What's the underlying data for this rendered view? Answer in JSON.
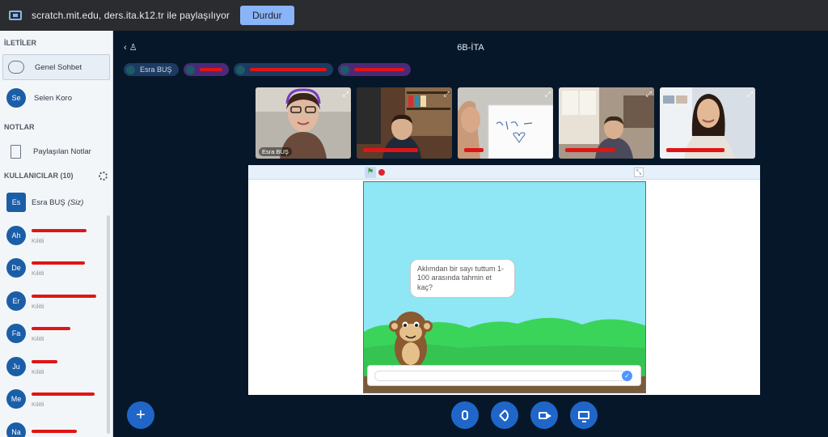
{
  "share_bar": {
    "message": "scratch.mit.edu, ders.ita.k12.tr ile paylaşılıyor",
    "stop_label": "Durdur"
  },
  "sidebar": {
    "messages_title": "İLETİLER",
    "public_chat": "Genel Sohbet",
    "private_chat": {
      "initials": "Se",
      "name": "Selen Koro"
    },
    "notes_title": "NOTLAR",
    "shared_notes": "Paylaşılan Notlar",
    "users_title": "KULLANICILAR (10)",
    "users": [
      {
        "initials": "Es",
        "name": "Esra BUŞ",
        "suffix": "(Siz)",
        "status": "",
        "redacted": false,
        "audio": "green"
      },
      {
        "initials": "Ah",
        "name": "",
        "status": "Kilitli",
        "redacted": true,
        "audio": "red"
      },
      {
        "initials": "De",
        "name": "",
        "status": "Kilitli",
        "redacted": true,
        "audio": "green"
      },
      {
        "initials": "Er",
        "name": "",
        "status": "Kilitli",
        "redacted": true,
        "audio": "red"
      },
      {
        "initials": "Fa",
        "name": "",
        "status": "Kilitli",
        "redacted": true,
        "audio": "red"
      },
      {
        "initials": "Ju",
        "name": "",
        "status": "Kilitli",
        "redacted": true,
        "audio": "green"
      },
      {
        "initials": "Me",
        "name": "",
        "status": "Kilitli",
        "redacted": true,
        "audio": "red"
      },
      {
        "initials": "Na",
        "name": "",
        "status": "",
        "redacted": true,
        "audio": "red"
      }
    ]
  },
  "main": {
    "title": "6B-İTA",
    "talkers": [
      {
        "name": "Esra BUŞ",
        "style": "blue"
      },
      {
        "name": "",
        "style": "purple"
      },
      {
        "name": "",
        "style": "blue"
      },
      {
        "name": "",
        "style": "purple"
      }
    ],
    "videos": [
      {
        "name": "Esra BUŞ",
        "scene": "teacher"
      },
      {
        "name": "",
        "scene": "boy-shelf"
      },
      {
        "name": "",
        "scene": "paper"
      },
      {
        "name": "",
        "scene": "boy-window"
      },
      {
        "name": "",
        "scene": "girl"
      }
    ]
  },
  "scratch": {
    "speech": "Aklımdan bir sayı tuttum 1-100 arasında tahmin et kaç?",
    "answer_value": ""
  },
  "colors": {
    "accent": "#1f66c8",
    "stage_sky": "#8fe6f5",
    "grass": "#3ad45a",
    "redaction": "#e01515"
  }
}
